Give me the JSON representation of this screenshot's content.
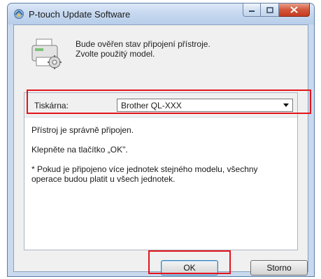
{
  "window": {
    "title": "P-touch Update Software"
  },
  "info": {
    "line1": "Bude ověřen stav připojení přístroje.",
    "line2": "Zvolte použitý model."
  },
  "printer": {
    "label": "Tiskárna:",
    "selected_model": "Brother QL-XXX"
  },
  "messages": {
    "connected": "Přístroj je správně připojen.",
    "press_ok": "Klepněte na tlačítko „OK\".",
    "note": "* Pokud je připojeno více jednotek stejného modelu, všechny operace budou platit u všech jednotek."
  },
  "buttons": {
    "ok": "OK",
    "cancel": "Storno"
  },
  "colors": {
    "highlight": "#e3141b",
    "window_frame": "#c9d9ee",
    "close_button": "#c63b21"
  }
}
